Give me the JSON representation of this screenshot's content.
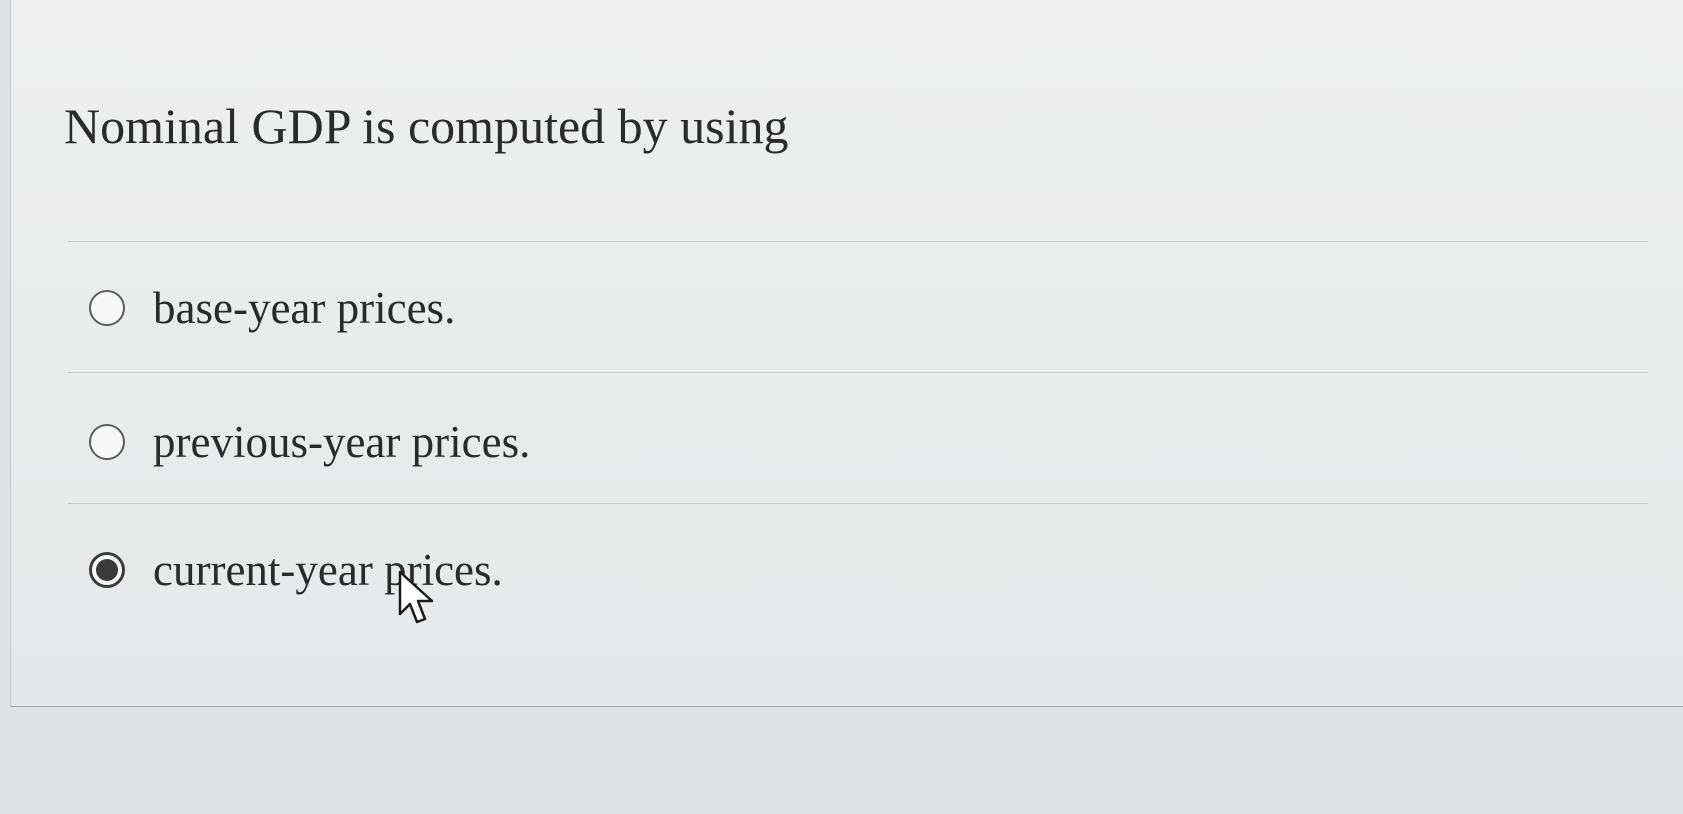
{
  "question": {
    "text": "Nominal GDP is computed by using"
  },
  "options": [
    {
      "label": "base-year prices.",
      "selected": false
    },
    {
      "label": "previous-year prices.",
      "selected": false
    },
    {
      "label": "current-year prices.",
      "selected": true
    }
  ],
  "icons": {
    "radio_unselected": "radio-empty-icon",
    "radio_selected": "radio-filled-icon",
    "pointer": "mouse-pointer-icon"
  },
  "colors": {
    "background": "#dfe2e2",
    "card": "#ececec",
    "text": "#2a2a2a",
    "radio_fill": "#3a3a3a",
    "divider": "#c8cccc"
  }
}
